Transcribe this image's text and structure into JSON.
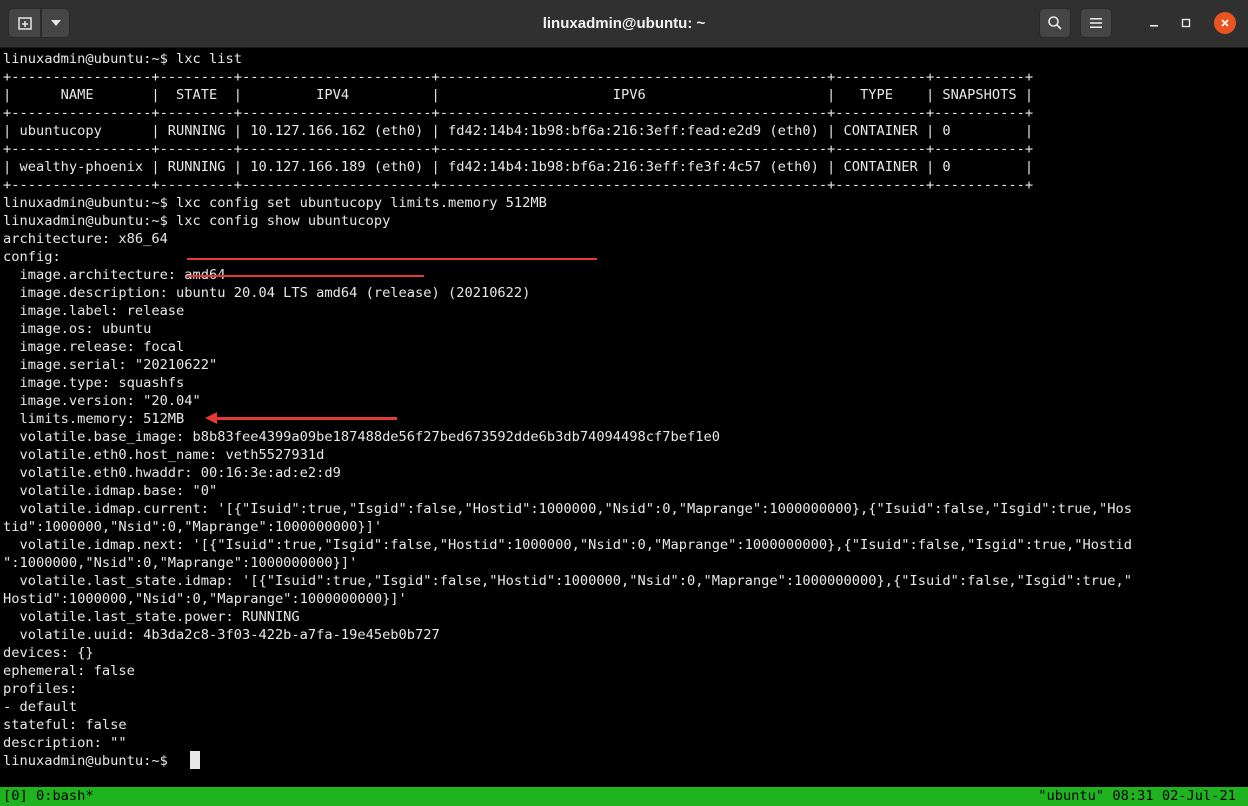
{
  "window": {
    "title": "linuxadmin@ubuntu: ~",
    "accent_close": "#e95420"
  },
  "terminal": {
    "lines": [
      "linuxadmin@ubuntu:~$ lxc list",
      "+-----------------+---------+-----------------------+-----------------------------------------------+-----------+-----------+",
      "|      NAME       |  STATE  |         IPV4          |                     IPV6                      |   TYPE    | SNAPSHOTS |",
      "+-----------------+---------+-----------------------+-----------------------------------------------+-----------+-----------+",
      "| ubuntucopy      | RUNNING | 10.127.166.162 (eth0) | fd42:14b4:1b98:bf6a:216:3eff:fead:e2d9 (eth0) | CONTAINER | 0         |",
      "+-----------------+---------+-----------------------+-----------------------------------------------+-----------+-----------+",
      "| wealthy-phoenix | RUNNING | 10.127.166.189 (eth0) | fd42:14b4:1b98:bf6a:216:3eff:fe3f:4c57 (eth0) | CONTAINER | 0         |",
      "+-----------------+---------+-----------------------+-----------------------------------------------+-----------+-----------+",
      "linuxadmin@ubuntu:~$ lxc config set ubuntucopy limits.memory 512MB",
      "linuxadmin@ubuntu:~$ lxc config show ubuntucopy",
      "architecture: x86_64",
      "config:",
      "  image.architecture: amd64",
      "  image.description: ubuntu 20.04 LTS amd64 (release) (20210622)",
      "  image.label: release",
      "  image.os: ubuntu",
      "  image.release: focal",
      "  image.serial: \"20210622\"",
      "  image.type: squashfs",
      "  image.version: \"20.04\"",
      "  limits.memory: 512MB",
      "  volatile.base_image: b8b83fee4399a09be187488de56f27bed673592dde6b3db74094498cf7bef1e0",
      "  volatile.eth0.host_name: veth5527931d",
      "  volatile.eth0.hwaddr: 00:16:3e:ad:e2:d9",
      "  volatile.idmap.base: \"0\"",
      "  volatile.idmap.current: '[{\"Isuid\":true,\"Isgid\":false,\"Hostid\":1000000,\"Nsid\":0,\"Maprange\":1000000000},{\"Isuid\":false,\"Isgid\":true,\"Hos",
      "tid\":1000000,\"Nsid\":0,\"Maprange\":1000000000}]'",
      "  volatile.idmap.next: '[{\"Isuid\":true,\"Isgid\":false,\"Hostid\":1000000,\"Nsid\":0,\"Maprange\":1000000000},{\"Isuid\":false,\"Isgid\":true,\"Hostid",
      "\":1000000,\"Nsid\":0,\"Maprange\":1000000000}]'",
      "  volatile.last_state.idmap: '[{\"Isuid\":true,\"Isgid\":false,\"Hostid\":1000000,\"Nsid\":0,\"Maprange\":1000000000},{\"Isuid\":false,\"Isgid\":true,\"",
      "Hostid\":1000000,\"Nsid\":0,\"Maprange\":1000000000}]'",
      "  volatile.last_state.power: RUNNING",
      "  volatile.uuid: 4b3da2c8-3f03-422b-a7fa-19e45eb0b727",
      "devices: {}",
      "ephemeral: false",
      "profiles:",
      "- default",
      "stateful: false",
      "description: \"\"",
      "linuxadmin@ubuntu:~$ "
    ],
    "text_color": "#e8e8e8",
    "background": "#000000",
    "annotation_color": "#e53935"
  },
  "statusbar": {
    "left": "[0] 0:bash*",
    "right": "\"ubuntu\" 08:31 02-Jul-21",
    "background": "#1fb41f"
  }
}
